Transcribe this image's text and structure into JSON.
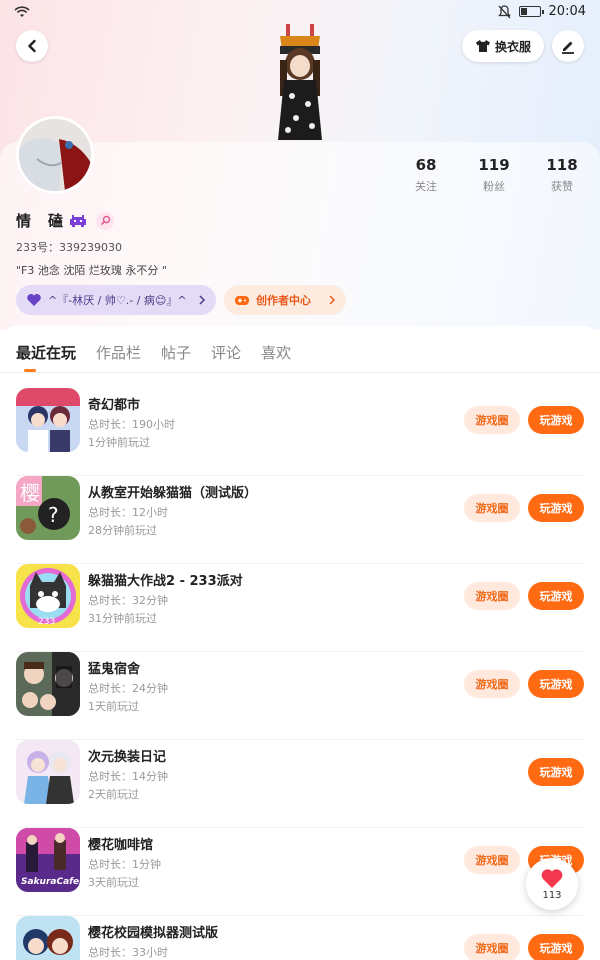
{
  "status_bar": {
    "time": "20:04"
  },
  "header": {
    "dress_button_label": "换衣服"
  },
  "profile": {
    "name": "情　磕",
    "uid_text": "233号：339239030",
    "bio": "\"F3 池念  沈陌  烂玫瑰  永不分 \"",
    "stats": [
      {
        "value": "68",
        "label": "关注"
      },
      {
        "value": "119",
        "label": "粉丝"
      },
      {
        "value": "118",
        "label": "获赞"
      }
    ],
    "fan_group_label": "^『-林厌 / 帅♡.- / 病😊』^",
    "creator_center_label": "创作者中心"
  },
  "tabs": [
    {
      "label": "最近在玩",
      "active": true
    },
    {
      "label": "作品栏",
      "active": false
    },
    {
      "label": "帖子",
      "active": false
    },
    {
      "label": "评论",
      "active": false
    },
    {
      "label": "喜欢",
      "active": false
    }
  ],
  "games": [
    {
      "title": "奇幻都市",
      "duration": "总时长：190小时",
      "last_played": "1分钟前玩过",
      "has_circle": true,
      "icon": "anime-girls-icon"
    },
    {
      "title": "从教室开始躲猫猫（测试版）",
      "duration": "总时长：12小时",
      "last_played": "28分钟前玩过",
      "has_circle": true,
      "icon": "sakura-mystery-icon"
    },
    {
      "title": "躲猫猫大作战2 - 233派对",
      "duration": "总时长：32分钟",
      "last_played": "31分钟前玩过",
      "has_circle": true,
      "icon": "cat-face-icon"
    },
    {
      "title": "猛鬼宿舍",
      "duration": "总时长：24分钟",
      "last_played": "1天前玩过",
      "has_circle": true,
      "icon": "haunted-dorm-icon"
    },
    {
      "title": "次元换装日记",
      "duration": "总时长：14分钟",
      "last_played": "2天前玩过",
      "has_circle": false,
      "icon": "dressup-girls-icon"
    },
    {
      "title": "樱花咖啡馆",
      "duration": "总时长：1分钟",
      "last_played": "3天前玩过",
      "has_circle": true,
      "icon": "sakura-cafe-icon"
    },
    {
      "title": "樱花校园模拟器测试版",
      "duration": "总时长：33小时",
      "last_played": "",
      "has_circle": true,
      "icon": "school-sim-icon"
    }
  ],
  "buttons": {
    "circle_label": "游戏圈",
    "play_label": "玩游戏"
  },
  "float_like": {
    "count": "113"
  },
  "colors": {
    "accent": "#ff6a12",
    "circle_bg": "#ffe9dc",
    "fan_pill_bg": "#e4dcf6",
    "creator_pill_bg": "#fdebe0"
  }
}
